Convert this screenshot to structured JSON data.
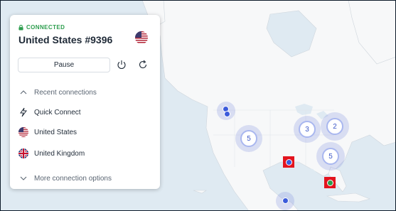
{
  "panel": {
    "status": "CONNECTED",
    "server_name": "United States #9396",
    "pause_label": "Pause",
    "recent_label": "Recent connections",
    "items": [
      {
        "label": "Quick Connect",
        "icon": "lightning-icon"
      },
      {
        "label": "United States",
        "icon": "us-flag-icon"
      },
      {
        "label": "United Kingdom",
        "icon": "uk-flag-icon"
      }
    ],
    "more_label": "More connection options"
  },
  "map": {
    "clusters": [
      {
        "count": "5"
      },
      {
        "count": "3"
      },
      {
        "count": "2"
      },
      {
        "count": "5"
      }
    ],
    "colors": {
      "connected": "#2c9d4d",
      "highlight": "#e3141e",
      "marker": "#3b5bdb",
      "highlight_marker_connected": "#2c9d4d"
    }
  }
}
